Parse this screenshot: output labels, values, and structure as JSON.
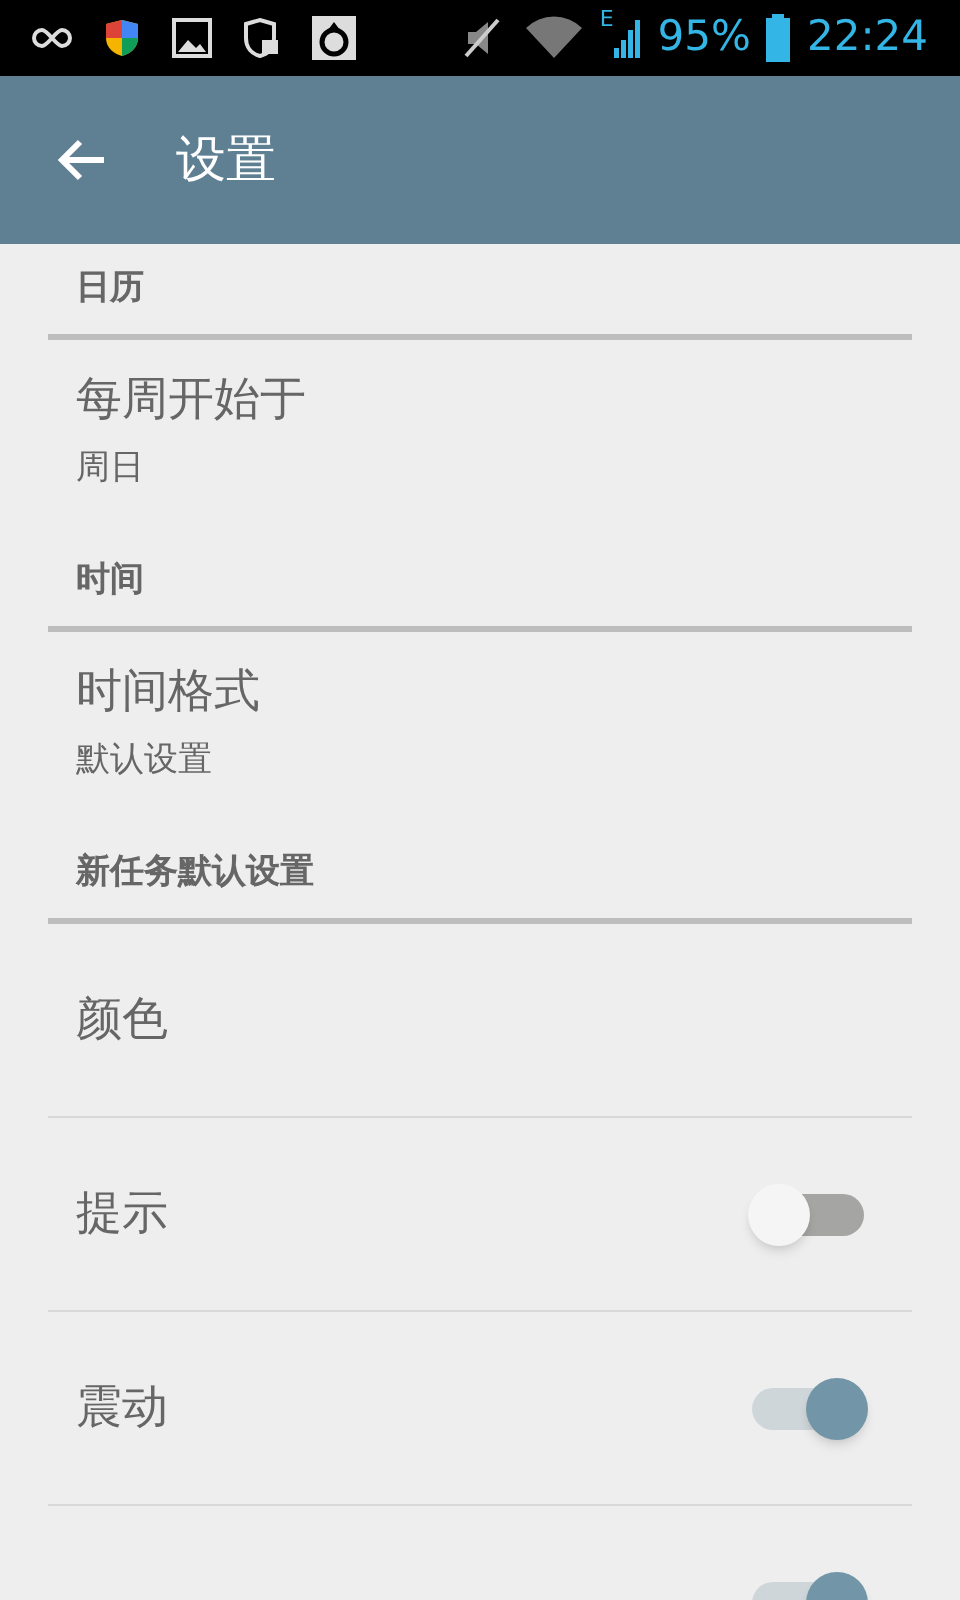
{
  "status_bar": {
    "network_type": "E",
    "battery": "95%",
    "time": "22:24"
  },
  "app_bar": {
    "title": "设置"
  },
  "sections": [
    {
      "header": "日历",
      "items": [
        {
          "kind": "detail",
          "title": "每周开始于",
          "value": "周日"
        }
      ]
    },
    {
      "header": "时间",
      "items": [
        {
          "kind": "detail",
          "title": "时间格式",
          "value": "默认设置"
        }
      ]
    },
    {
      "header": "新任务默认设置",
      "items": [
        {
          "kind": "plain",
          "title": "颜色"
        },
        {
          "kind": "switch",
          "title": "提示",
          "on": false
        },
        {
          "kind": "switch",
          "title": "震动",
          "on": true
        },
        {
          "kind": "switch",
          "on": true
        }
      ]
    }
  ]
}
